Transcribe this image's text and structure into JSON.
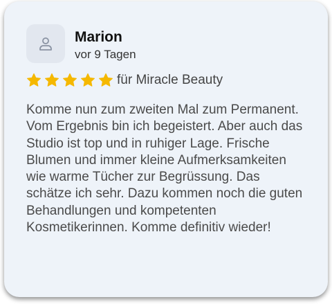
{
  "review": {
    "author_name": "Marion",
    "date": "vor 9 Tagen",
    "rating": 5,
    "max_rating": 5,
    "star_color": "#f5b800",
    "source": "für Miracle Beauty",
    "text": "Komme nun zum zweiten Mal zum Permanent. Vom Ergebnis bin ich begeistert. Aber auch das Studio ist top und in ruhiger Lage. Frische Blumen und immer kleine Aufmerksamkeiten wie warme Tücher zur Begrüssung. Das schätze ich sehr. Dazu kommen noch die guten Behandlungen und kompetenten Kosmetikerinnen. Komme definitiv wieder!"
  },
  "icons": {
    "avatar": "user-icon",
    "star": "star-icon"
  }
}
